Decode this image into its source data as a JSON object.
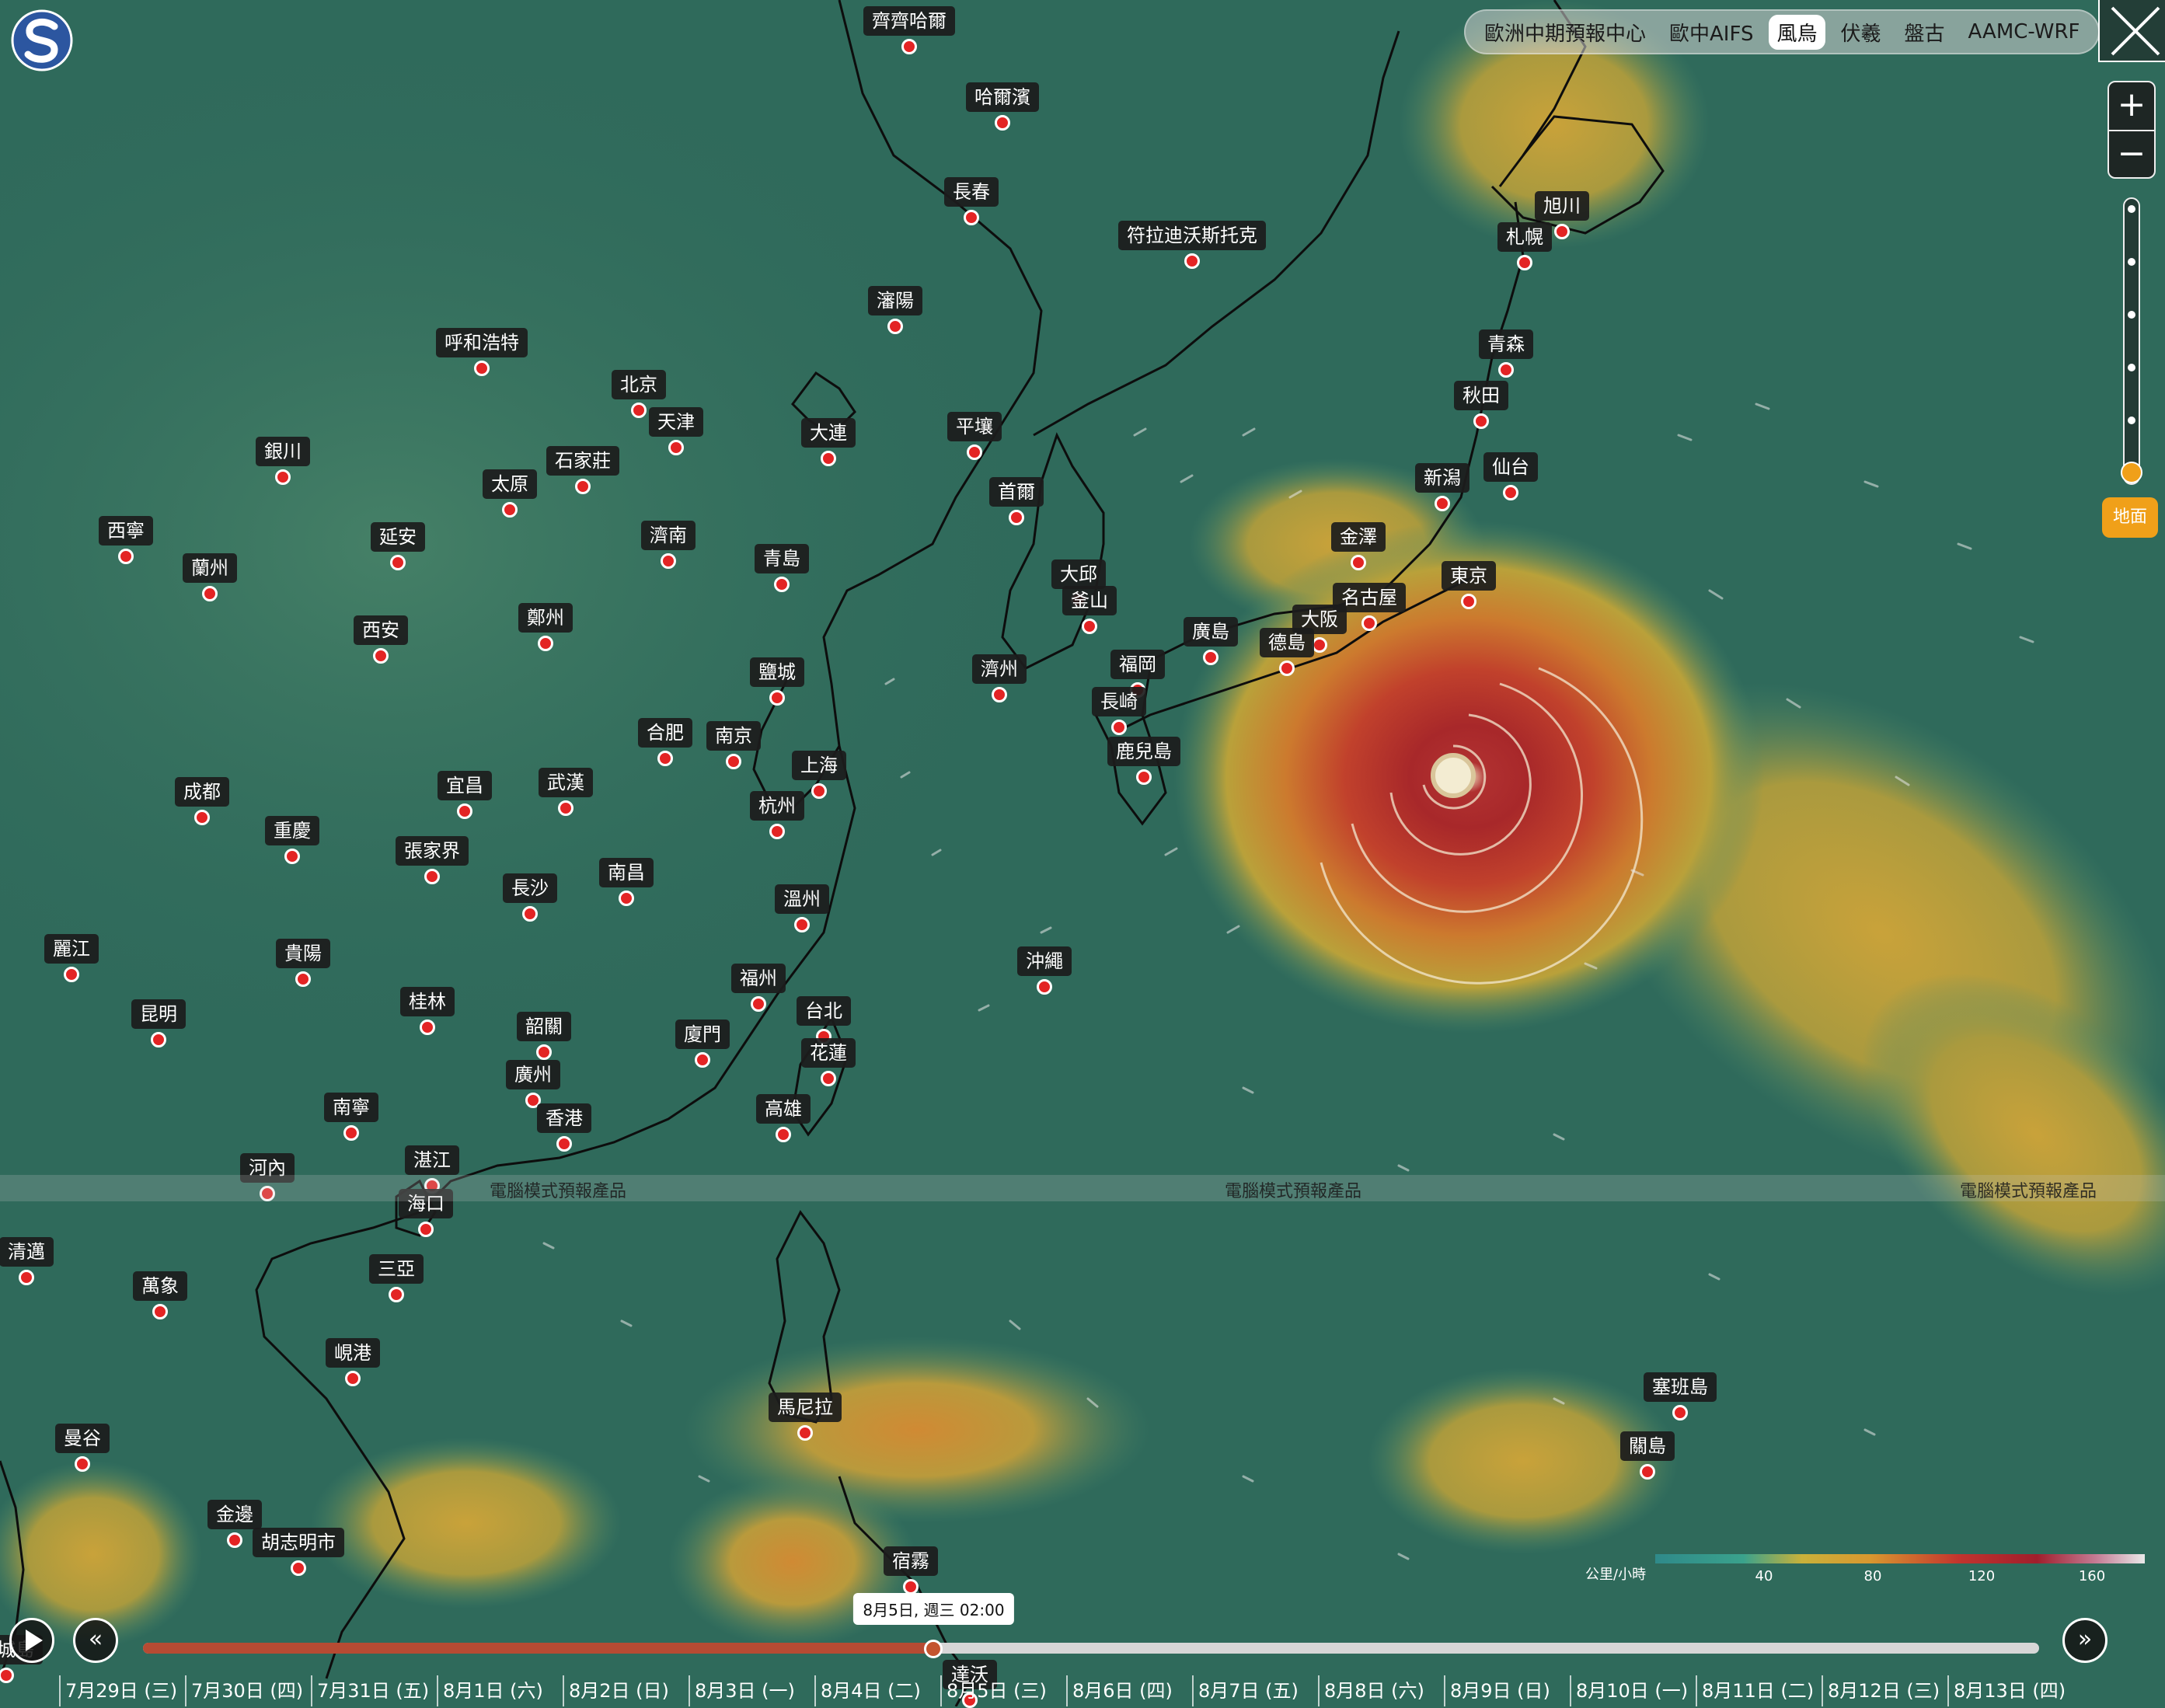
{
  "models": {
    "items": [
      "歐洲中期預報中心",
      "歐中AIFS",
      "風烏",
      "伏羲",
      "盤古",
      "AAMC-WRF"
    ],
    "active": "風烏"
  },
  "level_label": "地面",
  "watermark_text": "電腦模式預報產品",
  "legend": {
    "unit": "公里/小時",
    "ticks": [
      "40",
      "80",
      "120",
      "160"
    ]
  },
  "timeline": {
    "current": "8月5日, 週三 02:00",
    "progress_fraction": 0.417,
    "days": [
      "7月29日 (三)",
      "7月30日 (四)",
      "7月31日 (五)",
      "8月1日 (六)",
      "8月2日 (日)",
      "8月3日 (一)",
      "8月4日 (二)",
      "8月5日 (三)",
      "8月6日 (四)",
      "8月7日 (五)",
      "8月8日 (六)",
      "8月9日 (日)",
      "8月10日 (一)",
      "8月11日 (二)",
      "8月12日 (三)",
      "8月13日 (四)"
    ]
  },
  "cities": [
    "齊齊哈爾",
    "哈爾濱",
    "長春",
    "符拉迪沃斯托克",
    "旭川",
    "札幌",
    "瀋陽",
    "呼和浩特",
    "北京",
    "天津",
    "大連",
    "平壤",
    "青森",
    "秋田",
    "銀川",
    "石家莊",
    "太原",
    "首爾",
    "仙台",
    "新潟",
    "西寧",
    "延安",
    "濟南",
    "金澤",
    "蘭州",
    "青島",
    "大邱",
    "東京",
    "名古屋",
    "釜山",
    "大阪",
    "廣島",
    "德島",
    "鄭州",
    "西安",
    "福岡",
    "濟州",
    "鹽城",
    "長崎",
    "合肥",
    "南京",
    "上海",
    "鹿兒島",
    "成都",
    "宜昌",
    "武漢",
    "杭州",
    "重慶",
    "張家界",
    "南昌",
    "長沙",
    "溫州",
    "麗江",
    "貴陽",
    "沖繩",
    "福州",
    "台北",
    "桂林",
    "昆明",
    "韶關",
    "廈門",
    "花蓮",
    "廣州",
    "南寧",
    "高雄",
    "香港",
    "湛江",
    "河內",
    "海口",
    "清邁",
    "三亞",
    "萬象",
    "峴港",
    "塞班島",
    "馬尼拉",
    "關島",
    "曼谷",
    "金邊",
    "胡志明市",
    "宿霧",
    "達沃",
    "檳城島"
  ]
}
